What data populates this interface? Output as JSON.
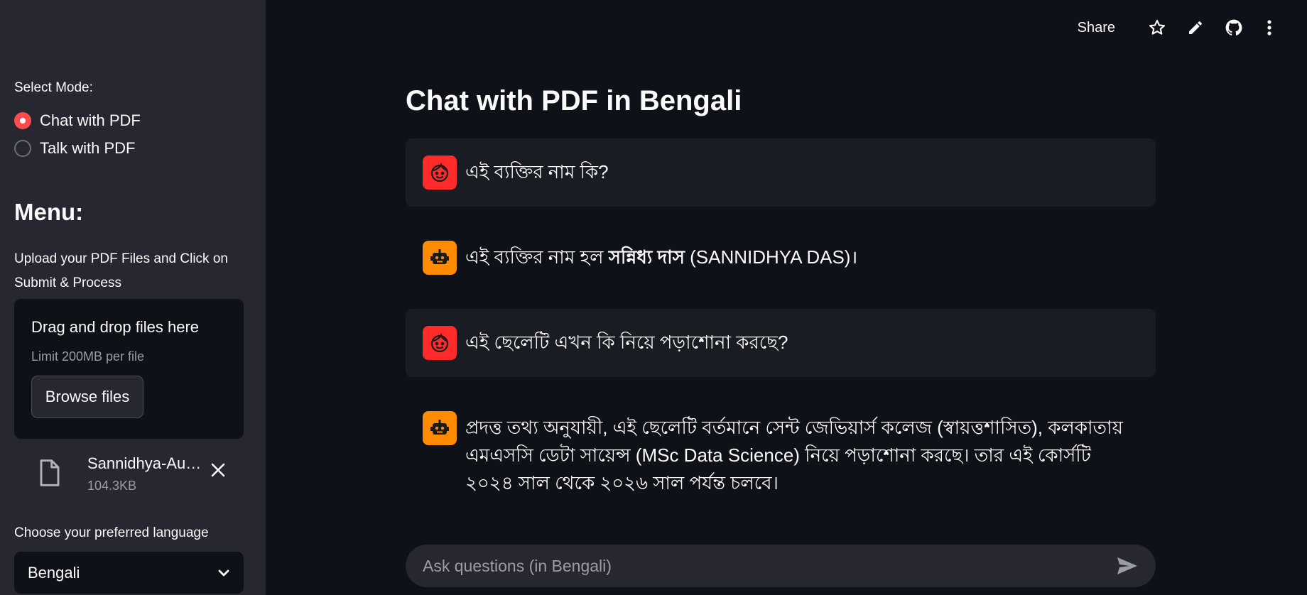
{
  "sidebar": {
    "mode_label": "Select Mode:",
    "modes": [
      {
        "label": "Chat with PDF",
        "selected": true
      },
      {
        "label": "Talk with PDF",
        "selected": false
      }
    ],
    "menu_title": "Menu:",
    "upload_instruction": "Upload your PDF Files and Click on Submit & Process",
    "dropzone": {
      "title": "Drag and drop files here",
      "limit": "Limit 200MB per file",
      "browse_label": "Browse files"
    },
    "file": {
      "name": "Sannidhya-Au…",
      "size": "104.3KB",
      "icon": "file-icon"
    },
    "language_label": "Choose your preferred language",
    "language_value": "Bengali"
  },
  "toolbar": {
    "share_label": "Share",
    "icons": [
      "star-icon",
      "pencil-icon",
      "github-icon",
      "more-vert-icon"
    ]
  },
  "main": {
    "title": "Chat with PDF in Bengali",
    "messages": [
      {
        "role": "user",
        "text": "এই ব্যক্তির নাম কি?"
      },
      {
        "role": "assistant",
        "text_before": "এই ব্যক্তির নাম হল ",
        "text_bold": "সন্নিধ্য দাস",
        "text_after": " (SANNIDHYA DAS)।"
      },
      {
        "role": "user",
        "text": "এই ছেলেটি এখন কি নিয়ে পড়াশোনা করছে?"
      },
      {
        "role": "assistant",
        "text": "প্রদত্ত তথ্য অনুযায়ী, এই ছেলেটি বর্তমানে সেন্ট জেভিয়ার্স কলেজ (স্বায়ত্তশাসিত), কলকাতায় এমএসসি ডেটা সায়েন্স (MSc Data Science) নিয়ে পড়াশোনা করছে। তার এই কোর্সটি ২০২৪ সাল থেকে ২০২৬ সাল পর্যন্ত চলবে।"
      }
    ],
    "input_placeholder": "Ask questions (in Bengali)"
  },
  "colors": {
    "background": "#0e1117",
    "sidebar": "#262730",
    "accent": "#ff4b4b",
    "user_avatar": "#ff2b2b",
    "bot_avatar": "#ff8c00"
  }
}
